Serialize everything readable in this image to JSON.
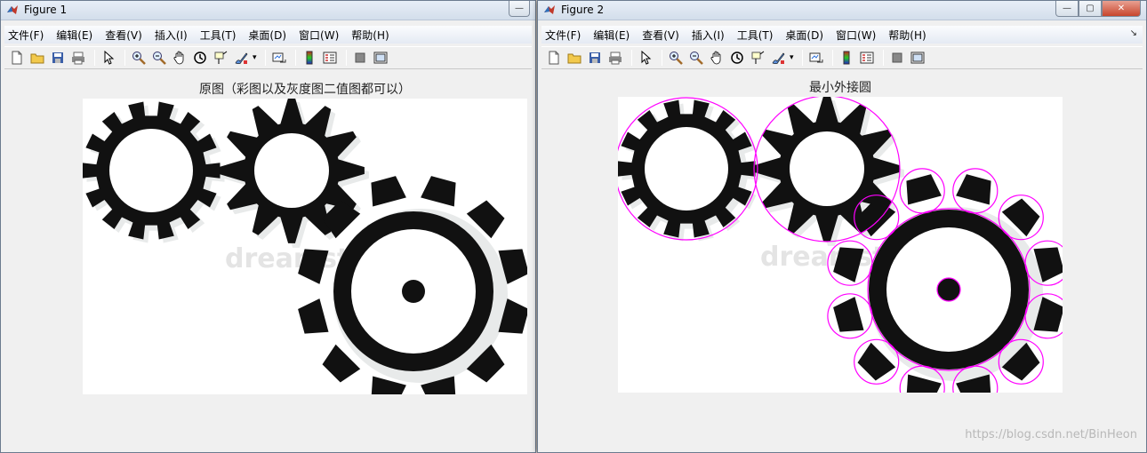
{
  "windows": [
    {
      "title": "Figure 1",
      "axes_title": "原图（彩图以及灰度图二值图都可以）",
      "show_circles": false
    },
    {
      "title": "Figure 2",
      "axes_title": "最小外接圆",
      "show_circles": true
    }
  ],
  "menu": [
    "文件(F)",
    "编辑(E)",
    "查看(V)",
    "插入(I)",
    "工具(T)",
    "桌面(D)",
    "窗口(W)",
    "帮助(H)"
  ],
  "toolbar_icons": [
    "new-figure-icon",
    "open-file-icon",
    "save-icon",
    "print-icon",
    "pointer-icon",
    "zoom-in-icon",
    "zoom-out-icon",
    "pan-hand-icon",
    "rotate-3d-icon",
    "data-cursor-icon",
    "brush-icon",
    "link-plot-icon",
    "colorbar-icon",
    "legend-icon",
    "hide-plot-tools-icon",
    "show-plot-tools-icon"
  ],
  "image_watermark": "dreamstime.com",
  "watermark": "https://blog.csdn.net/BinHeon",
  "circle_color": "#ff00ff"
}
